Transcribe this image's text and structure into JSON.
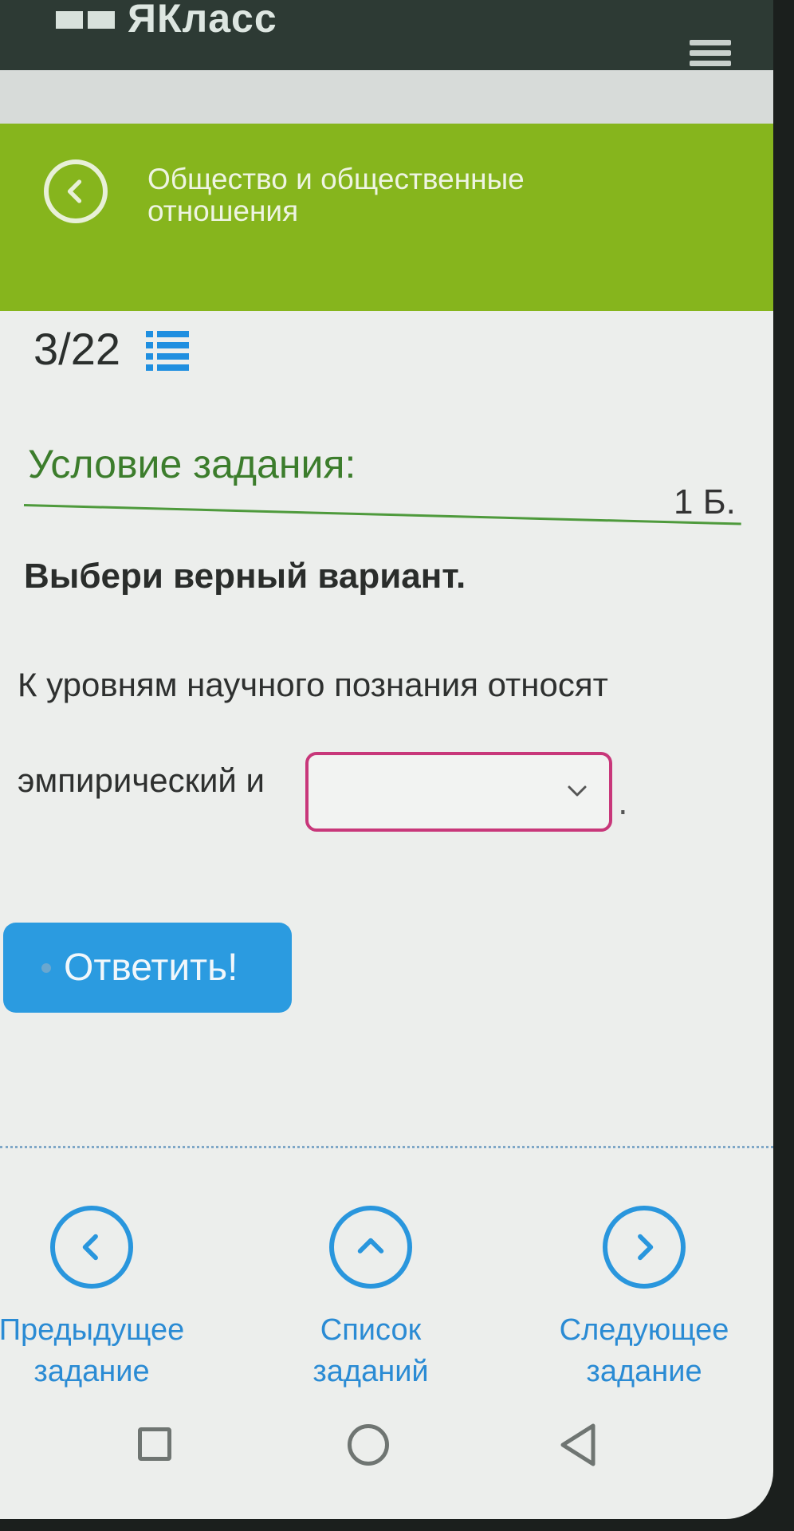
{
  "app": {
    "logo_text": "ЯКласс"
  },
  "topic": {
    "title": "Общество и общественные отношения"
  },
  "progress": {
    "counter": "3/22"
  },
  "task": {
    "condition_title": "Условие задания:",
    "score": "1 Б.",
    "instruction": "Выбери верный вариант.",
    "question_line1": "К уровням научного познания относят",
    "question_line2": "эмпирический и",
    "select_value": "",
    "period": "."
  },
  "actions": {
    "submit_label": "Ответить!"
  },
  "navigation": {
    "prev_line1": "Предыдущее",
    "prev_line2": "задание",
    "list_line1": "Список",
    "list_line2": "заданий",
    "next_line1": "Следующее",
    "next_line2": "задание"
  },
  "colors": {
    "header_bg": "#2d3a34",
    "topic_bar": "#86b51d",
    "accent_blue": "#2b9be0",
    "condition_green": "#3c7d2c",
    "select_border": "#c8377a"
  }
}
